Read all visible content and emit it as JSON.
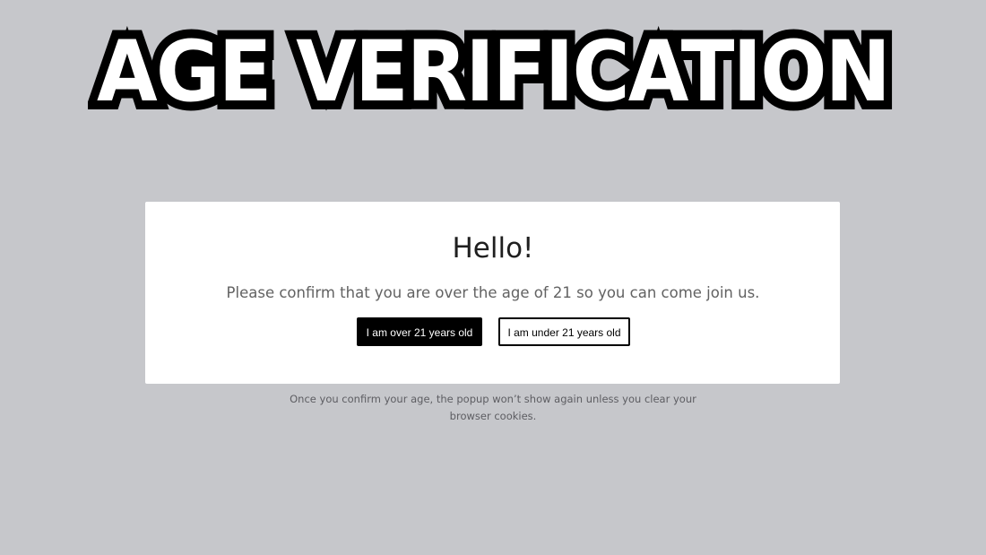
{
  "banner": {
    "title": "AGE VERIFICATION"
  },
  "modal": {
    "heading": "Hello!",
    "message": "Please confirm that you are over the age of 21 so you can come join us.",
    "confirm_label": "I am over 21 years old",
    "deny_label": "I am under 21 years old"
  },
  "footnote": {
    "text": "Once you confirm your age, the popup won’t show again unless you clear your browser cookies."
  },
  "colors": {
    "background": "#c6c7cb",
    "modal_background": "#ffffff",
    "primary_button": "#000000",
    "text_dark": "#1f1f1f",
    "text_muted": "#626262"
  }
}
